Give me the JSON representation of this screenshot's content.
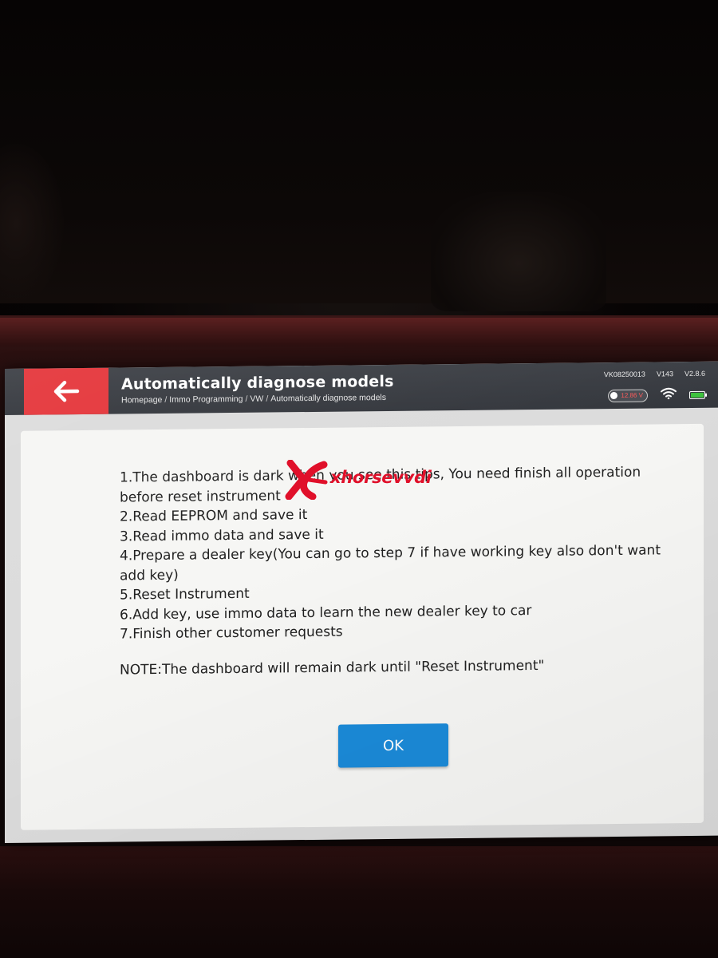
{
  "header": {
    "title": "Automatically diagnose models",
    "breadcrumb": [
      "Homepage",
      "Immo Programming",
      "VW",
      "Automatically diagnose models"
    ],
    "breadcrumb_separator": "/",
    "device_id": "VK08250013",
    "version_main": "V143",
    "version_app": "V2.8.6",
    "voltage": "12.86 V",
    "icons": {
      "back": "arrow-left-icon",
      "wifi": "wifi-icon",
      "battery": "battery-icon"
    },
    "colors": {
      "header_bg": "#393c42",
      "back_button_bg": "#e5363b",
      "voltage_text": "#ff5a5a",
      "battery_fill": "#3ec23e"
    }
  },
  "dialog": {
    "lines": [
      "1.The dashboard is dark when you see this tips, You need finish all operation",
      "before reset instrument",
      "2.Read EEPROM and save it",
      "3.Read immo data and save it",
      "4.Prepare a dealer key(You can go to step 7 if have working key also don't want",
      "add key)",
      "5.Reset Instrument",
      "6.Add key, use immo data to learn the new dealer key to car",
      "7.Finish other customer requests"
    ],
    "note": "NOTE:The dashboard will remain dark until \"Reset Instrument\"",
    "ok_label": "OK",
    "colors": {
      "ok_button": "#1b8ad8",
      "dialog_bg": "#f6f6f4"
    }
  },
  "watermark": {
    "text": "xhorsevvdi",
    "color": "#e0102a"
  }
}
